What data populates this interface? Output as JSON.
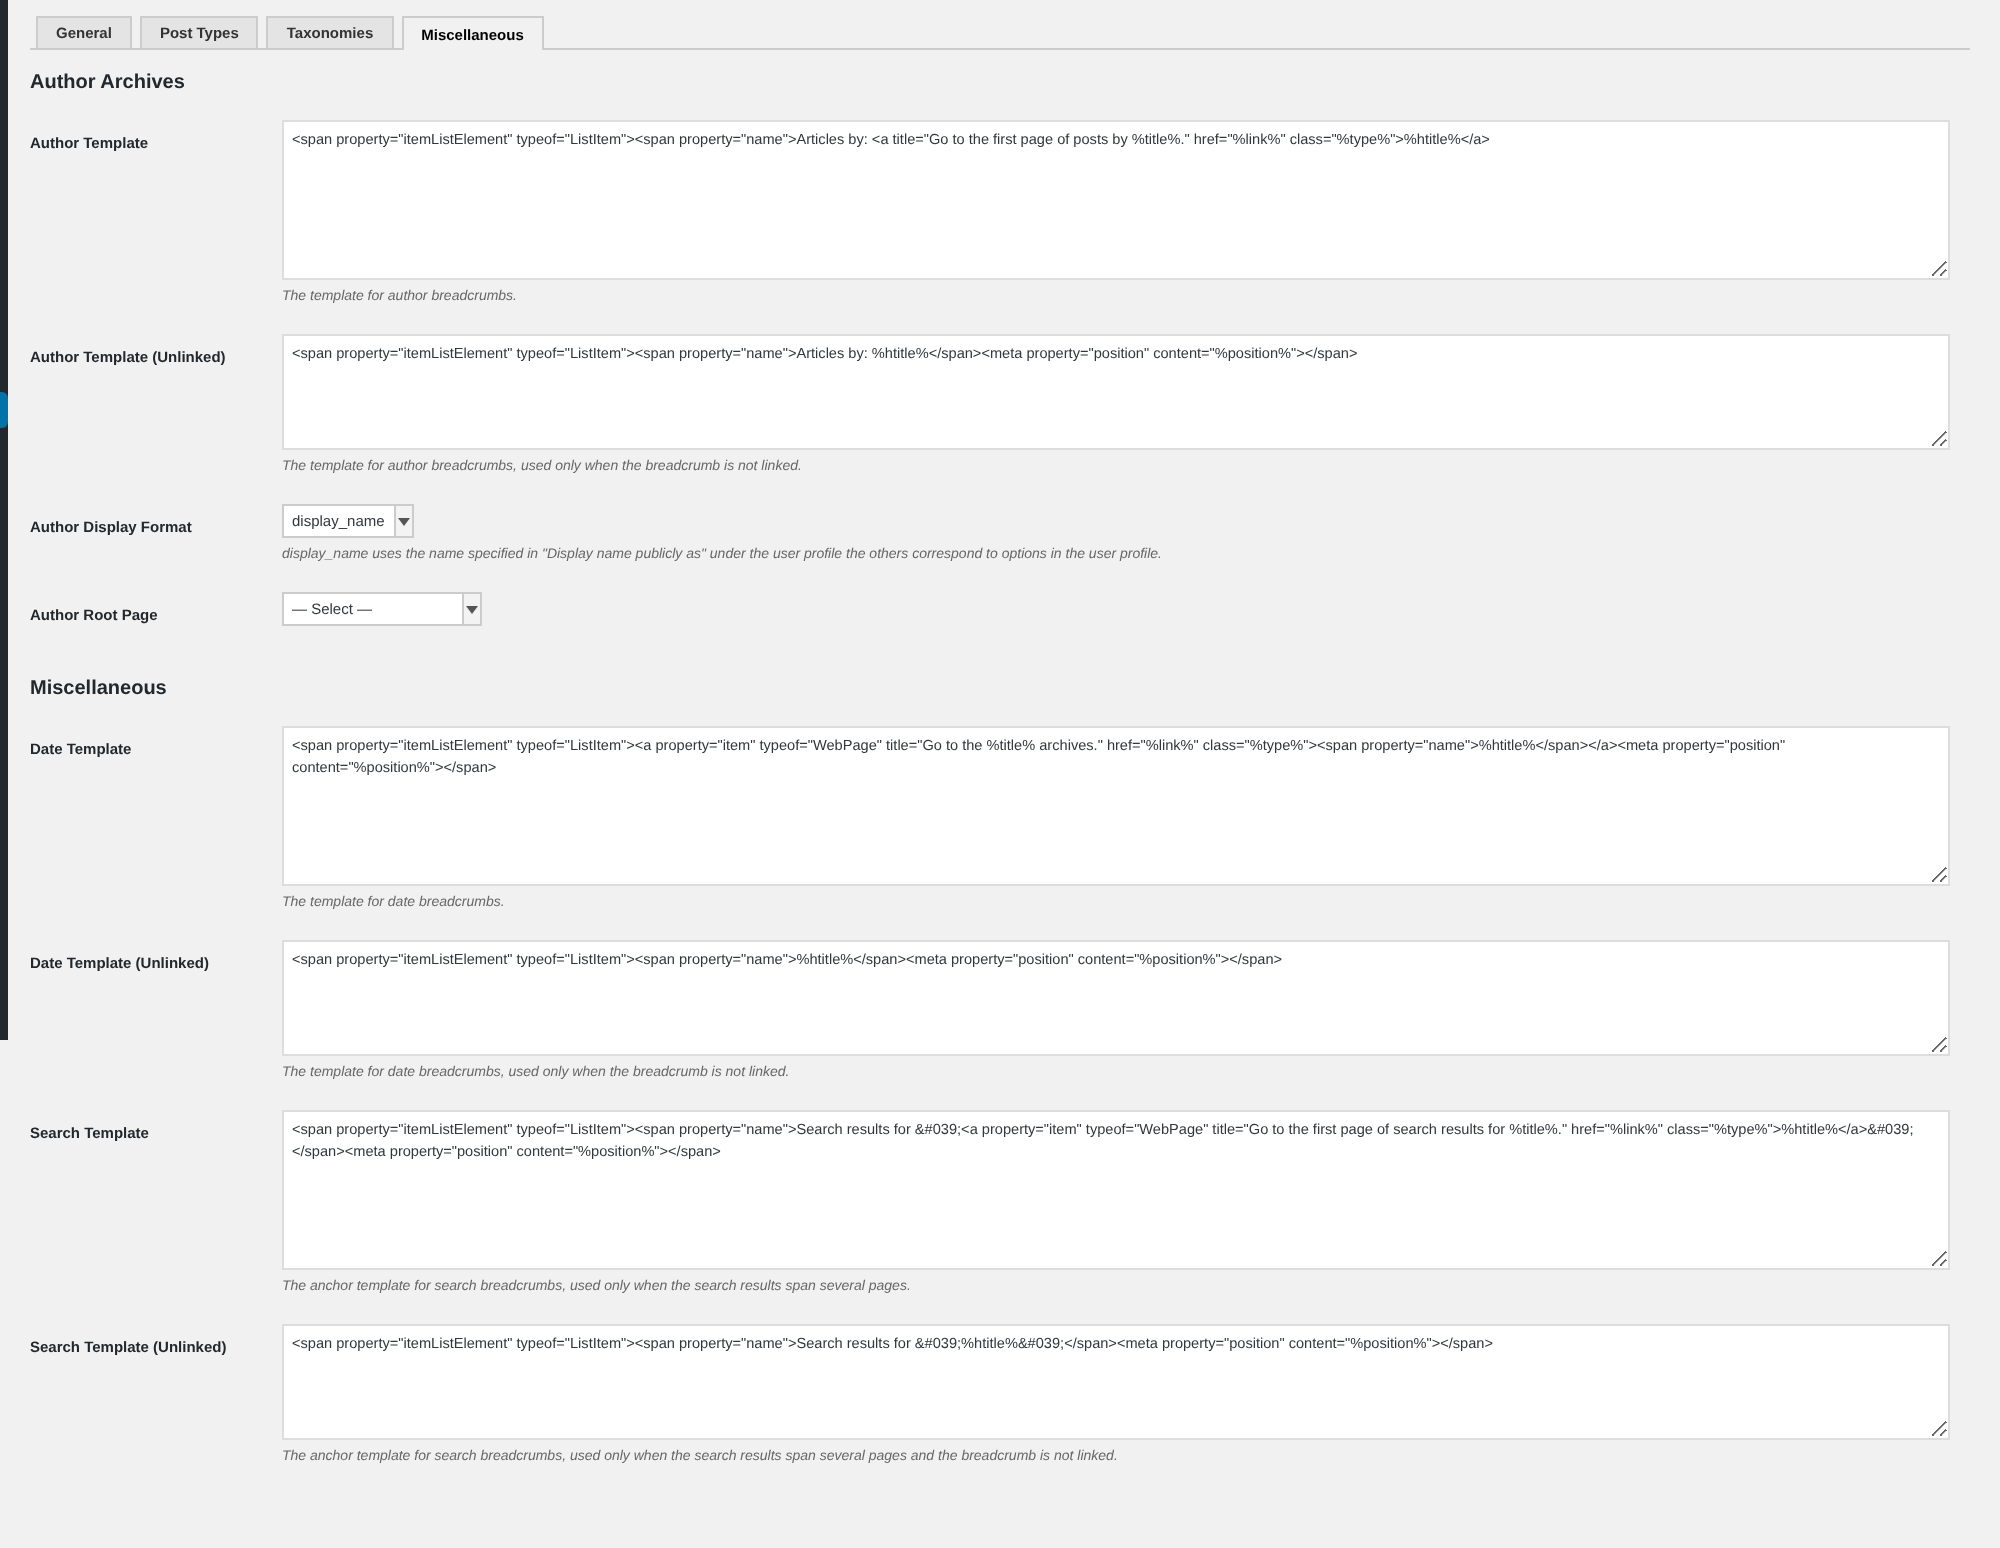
{
  "tabs": [
    {
      "label": "General",
      "selected": false
    },
    {
      "label": "Post Types",
      "selected": false
    },
    {
      "label": "Taxonomies",
      "selected": false
    },
    {
      "label": "Miscellaneous",
      "selected": true
    }
  ],
  "sections": [
    {
      "heading": "Author Archives",
      "rows": [
        {
          "label": "Author Template",
          "kind": "textarea",
          "value": "<span property=\"itemListElement\" typeof=\"ListItem\"><span property=\"name\">Articles by: <a title=\"Go to the first page of posts by %title%.\" href=\"%link%\" class=\"%type%\">%htitle%</a>",
          "description": "The template for author breadcrumbs."
        },
        {
          "label": "Author Template (Unlinked)",
          "kind": "short-textarea",
          "value": "<span property=\"itemListElement\" typeof=\"ListItem\"><span property=\"name\">Articles by: %htitle%</span><meta property=\"position\" content=\"%position%\"></span>",
          "description": "The template for author breadcrumbs, used only when the breadcrumb is not linked."
        },
        {
          "label": "Author Display Format",
          "kind": "select",
          "value": "display_name",
          "description": "display_name uses the name specified in \"Display name publicly as\" under the user profile the others correspond to options in the user profile."
        },
        {
          "label": "Author Root Page",
          "kind": "page-select",
          "value": "— Select —"
        }
      ]
    },
    {
      "heading": "Miscellaneous",
      "rows": [
        {
          "label": "Date Template",
          "kind": "textarea",
          "value": "<span property=\"itemListElement\" typeof=\"ListItem\"><a property=\"item\" typeof=\"WebPage\" title=\"Go to the %title% archives.\" href=\"%link%\" class=\"%type%\"><span property=\"name\">%htitle%</span></a><meta property=\"position\" content=\"%position%\"></span>",
          "description": "The template for date breadcrumbs."
        },
        {
          "label": "Date Template (Unlinked)",
          "kind": "short-textarea",
          "value": "<span property=\"itemListElement\" typeof=\"ListItem\"><span property=\"name\">%htitle%</span><meta property=\"position\" content=\"%position%\"></span>",
          "description": "The template for date breadcrumbs, used only when the breadcrumb is not linked."
        },
        {
          "label": "Search Template",
          "kind": "textarea",
          "value": "<span property=\"itemListElement\" typeof=\"ListItem\"><span property=\"name\">Search results for &#039;<a property=\"item\" typeof=\"WebPage\" title=\"Go to the first page of search results for %title%.\" href=\"%link%\" class=\"%type%\">%htitle%</a>&#039;</span><meta property=\"position\" content=\"%position%\"></span>",
          "description": "The anchor template for search breadcrumbs, used only when the search results span several pages."
        },
        {
          "label": "Search Template (Unlinked)",
          "kind": "short-textarea",
          "value": "<span property=\"itemListElement\" typeof=\"ListItem\"><span property=\"name\">Search results for &#039;%htitle%&#039;</span><meta property=\"position\" content=\"%position%\"></span>",
          "description": "The anchor template for search breadcrumbs, used only when the search results span several pages and the breadcrumb is not linked."
        }
      ]
    }
  ]
}
